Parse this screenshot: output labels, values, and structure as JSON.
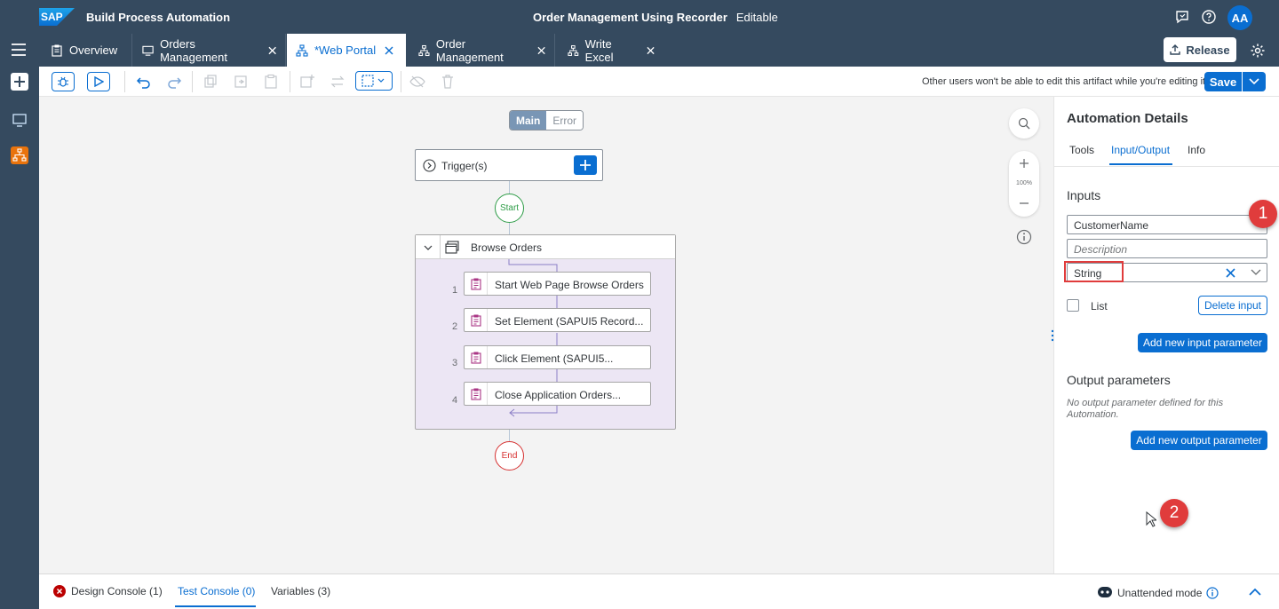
{
  "shell": {
    "logo_text": "SAP",
    "product": "Build Process Automation",
    "project_title": "Order Management Using Recorder",
    "project_status": "Editable",
    "avatar_initials": "AA"
  },
  "tabs": [
    {
      "label": "Overview",
      "icon": "clipboard-icon",
      "closable": false,
      "active": false
    },
    {
      "label": "Orders Management",
      "icon": "monitor-icon",
      "closable": true,
      "active": false
    },
    {
      "label": "*Web Portal",
      "icon": "automation-icon",
      "closable": true,
      "active": true
    },
    {
      "label": "Order Management",
      "icon": "automation-icon",
      "closable": true,
      "active": false
    },
    {
      "label": "Write Excel",
      "icon": "automation-icon",
      "closable": true,
      "active": false
    }
  ],
  "release": {
    "label": "Release"
  },
  "toolbar": {
    "message": "Other users won't be able to edit this artifact while you're editing it.",
    "save_label": "Save"
  },
  "canvas": {
    "segment_main": "Main",
    "segment_error": "Error",
    "trigger_label": "Trigger(s)",
    "start_label": "Start",
    "end_label": "End",
    "group_label": "Browse Orders",
    "steps": [
      {
        "num": "1",
        "label": "Start Web Page Browse Orders"
      },
      {
        "num": "2",
        "label": "Set Element (SAPUI5 Record..."
      },
      {
        "num": "3",
        "label": "Click Element (SAPUI5..."
      },
      {
        "num": "4",
        "label": "Close Application Orders..."
      }
    ],
    "zoom_level": "100%"
  },
  "panel": {
    "title": "Automation Details",
    "tabs": [
      "Tools",
      "Input/Output",
      "Info"
    ],
    "active_tab": "Input/Output",
    "inputs_heading": "Inputs",
    "input_name": "CustomerName",
    "description_placeholder": "Description",
    "type_value": "String",
    "list_label": "List",
    "delete_input_label": "Delete input",
    "add_input_label": "Add new input parameter",
    "outputs_heading": "Output parameters",
    "no_output_text": "No output parameter defined for this Automation.",
    "add_output_label": "Add new output parameter"
  },
  "annotations": {
    "badge1": "1",
    "badge2": "2"
  },
  "bottom": {
    "design_console": "Design Console (1)",
    "test_console": "Test Console (0)",
    "variables": "Variables (3)",
    "mode": "Unattended mode"
  },
  "colors": {
    "shell_bg": "#354a5f",
    "accent": "#0a6ed1",
    "start": "#2f9d48",
    "end": "#d63030",
    "group_bg": "#ece6f4",
    "annotation_red": "#e03c3c"
  }
}
